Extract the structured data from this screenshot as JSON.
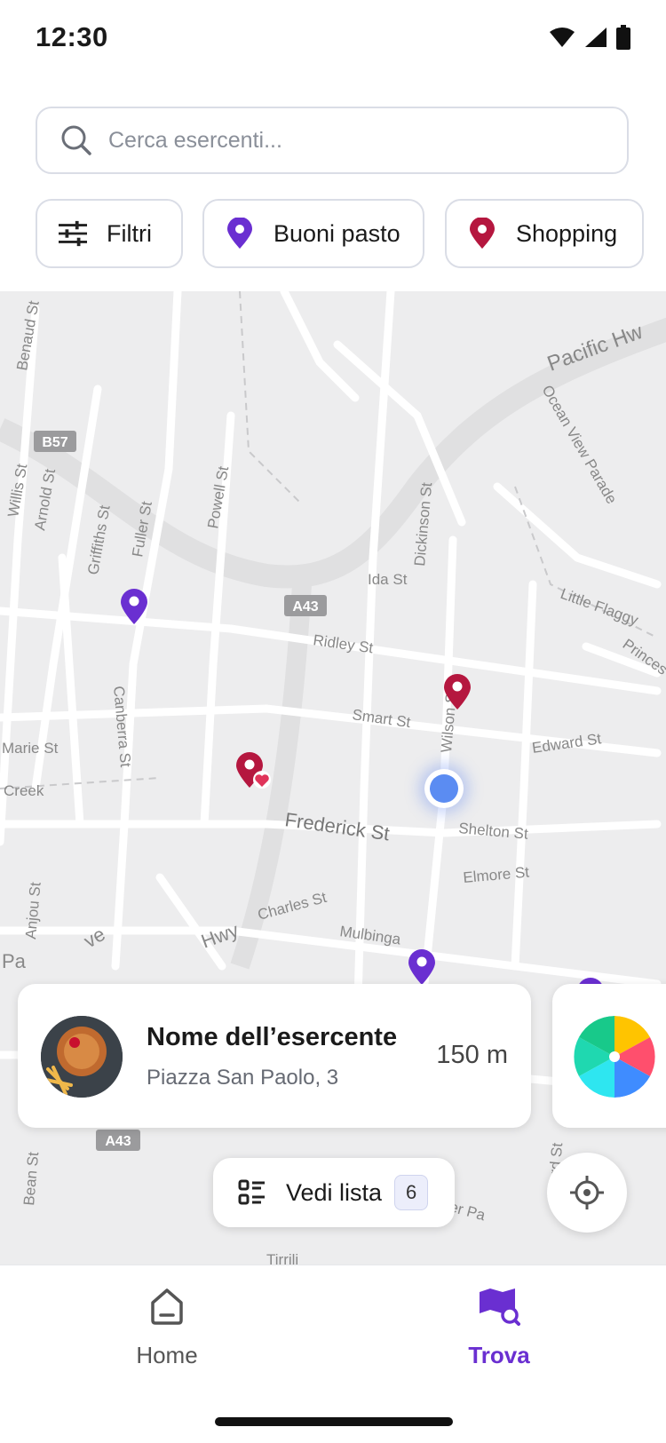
{
  "status": {
    "time": "12:30"
  },
  "search": {
    "placeholder": "Cerca esercenti..."
  },
  "chips": [
    {
      "label": "Filtri",
      "icon": "sliders-icon"
    },
    {
      "label": "Buoni pasto",
      "icon": "purple-pin-icon"
    },
    {
      "label": "Shopping",
      "icon": "red-pin-icon"
    }
  ],
  "map": {
    "labels": [
      "Pacific Hw",
      "Ocean View Parade",
      "Benaud St",
      "B57",
      "Willis St",
      "Arnold St",
      "Griffiths St",
      "Fuller St",
      "Powell St",
      "Dickinson St",
      "Ida St",
      "A43",
      "Little Flaggy",
      "Ridley St",
      "Princes",
      "Wilson St",
      "Canberra St",
      "Smart St",
      "Edward St",
      "Marie St",
      "Creek",
      "Frederick St",
      "Shelton St",
      "Elmore St",
      "Charles St",
      "Mulbinga",
      "Anjou St",
      "Hwy",
      "Pa",
      "ve",
      "Bean St",
      "Tirrili",
      "Alexander Pa",
      "Ward St",
      "A43"
    ]
  },
  "merchant": {
    "name": "Nome dell’esercente",
    "address": "Piazza San Paolo, 3",
    "distance": "150 m"
  },
  "list_button": {
    "label": "Vedi lista",
    "count": "6"
  },
  "nav": {
    "home": "Home",
    "find": "Trova"
  },
  "colors": {
    "accent": "#6a2fd1",
    "shopping": "#b5173f",
    "user": "#5b8cf2"
  }
}
